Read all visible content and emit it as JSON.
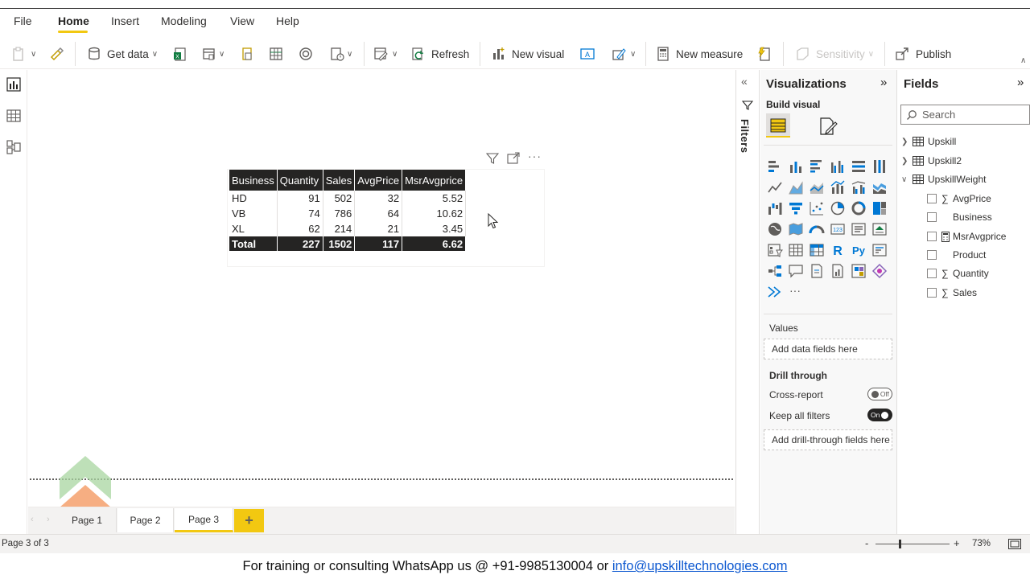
{
  "menu": {
    "tabs": [
      "File",
      "Home",
      "Insert",
      "Modeling",
      "View",
      "Help"
    ],
    "active": "Home"
  },
  "ribbon": {
    "get_data": "Get data",
    "refresh": "Refresh",
    "new_visual": "New visual",
    "new_measure": "New measure",
    "sensitivity": "Sensitivity",
    "publish": "Publish"
  },
  "table": {
    "headers": [
      "Business",
      "Quantity",
      "Sales",
      "AvgPrice",
      "MsrAvgprice"
    ],
    "rows": [
      [
        "HD",
        "91",
        "502",
        "32",
        "5.52"
      ],
      [
        "VB",
        "74",
        "786",
        "64",
        "10.62"
      ],
      [
        "XL",
        "62",
        "214",
        "21",
        "3.45"
      ]
    ],
    "total": [
      "Total",
      "227",
      "1502",
      "117",
      "6.62"
    ]
  },
  "pages": {
    "tabs": [
      "Page 1",
      "Page 2",
      "Page 3"
    ],
    "active": "Page 3",
    "add_label": "+"
  },
  "status": {
    "page_indicator": "Page 3 of 3",
    "zoom": "73%",
    "zoom_minus": "-",
    "zoom_plus": "+"
  },
  "filters": {
    "label": "Filters"
  },
  "visualizations": {
    "title": "Visualizations",
    "build_visual": "Build visual",
    "values_label": "Values",
    "values_placeholder": "Add data fields here",
    "drill_through": "Drill through",
    "cross_report": "Cross-report",
    "cross_report_state": "Off",
    "keep_all_filters": "Keep all filters",
    "keep_all_filters_state": "On",
    "drill_placeholder": "Add drill-through fields here",
    "more": "···"
  },
  "fields": {
    "title": "Fields",
    "search_placeholder": "Search",
    "tables": [
      "Upskill",
      "Upskill2",
      "UpskillWeight"
    ],
    "items": [
      {
        "name": "AvgPrice",
        "prefix": "∑"
      },
      {
        "name": "Business",
        "prefix": ""
      },
      {
        "name": "MsrAvgprice",
        "prefix": "calc"
      },
      {
        "name": "Product",
        "prefix": ""
      },
      {
        "name": "Quantity",
        "prefix": "∑"
      },
      {
        "name": "Sales",
        "prefix": "∑"
      }
    ]
  },
  "footer": {
    "text": "For training or consulting WhatsApp us @ +91-9985130004 or ",
    "email": "info@upskilltechnologies.com"
  },
  "colors": {
    "accent": "#f2c811",
    "header_dark": "#252423",
    "pane_bg": "#f8f8f8"
  }
}
